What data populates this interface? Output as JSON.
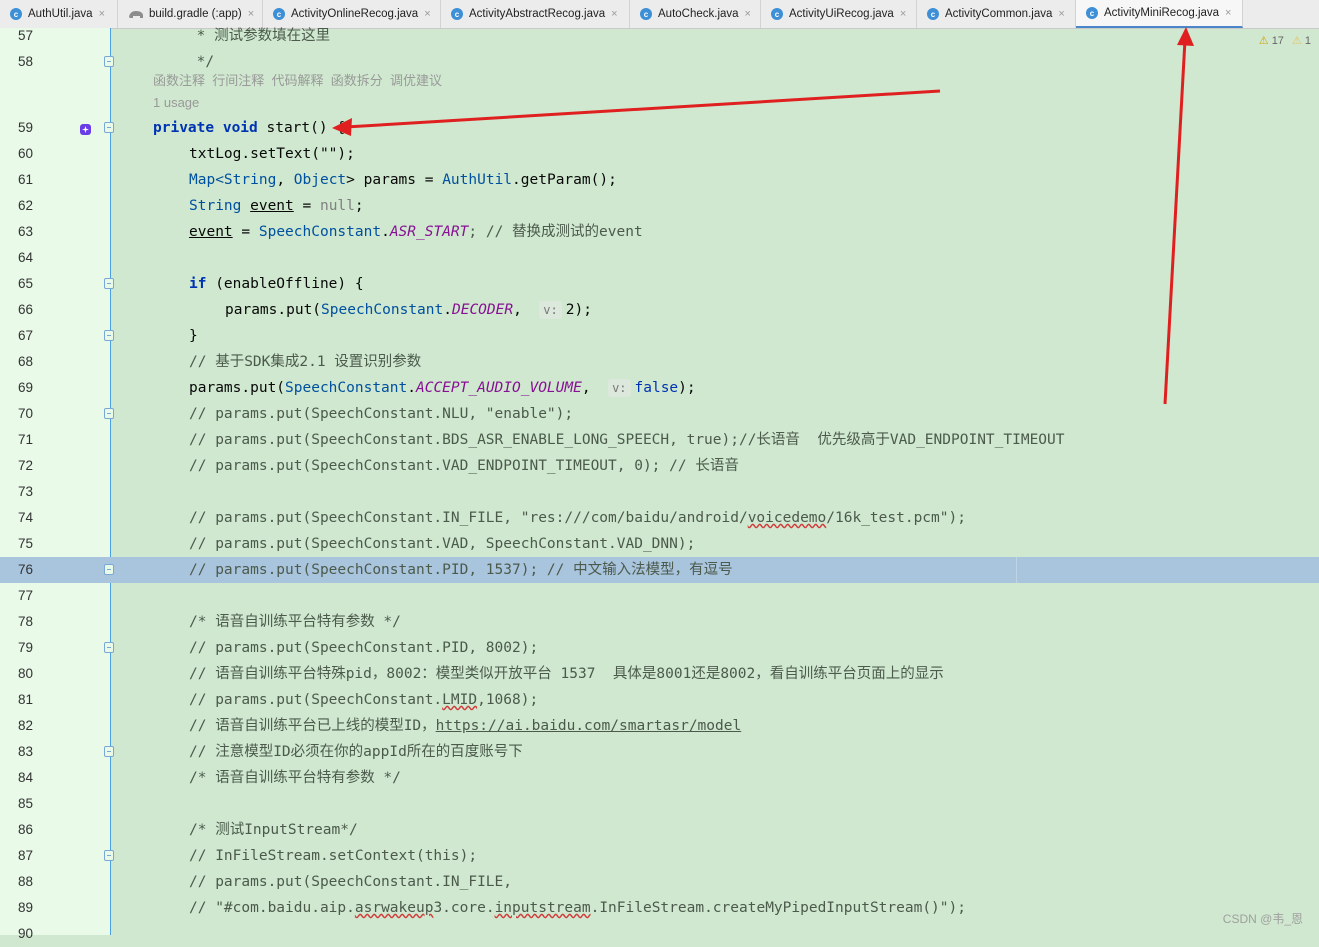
{
  "tabs": [
    {
      "label": "AuthUtil.java",
      "icon": "java-class-icon",
      "active": false
    },
    {
      "label": "build.gradle (:app)",
      "icon": "gradle-elephant-icon",
      "active": false
    },
    {
      "label": "ActivityOnlineRecog.java",
      "icon": "java-class-icon",
      "active": false
    },
    {
      "label": "ActivityAbstractRecog.java",
      "icon": "java-class-icon",
      "active": false
    },
    {
      "label": "AutoCheck.java",
      "icon": "java-class-icon",
      "active": false
    },
    {
      "label": "ActivityUiRecog.java",
      "icon": "java-class-icon",
      "active": false
    },
    {
      "label": "ActivityCommon.java",
      "icon": "java-class-icon",
      "active": false
    },
    {
      "label": "ActivityMiniRecog.java",
      "icon": "java-class-icon",
      "active": true
    }
  ],
  "close_glyph": "×",
  "class_glyph": "c",
  "warnings": {
    "count_a": "17",
    "count_b": "1"
  },
  "ai_actions": [
    "函数注释",
    "行间注释",
    "代码解释",
    "函数拆分",
    "调优建议"
  ],
  "usage_label": "1 usage",
  "line_numbers": [
    "57",
    "58",
    "59",
    "60",
    "61",
    "62",
    "63",
    "64",
    "65",
    "66",
    "67",
    "68",
    "69",
    "70",
    "71",
    "72",
    "73",
    "74",
    "75",
    "76",
    "77",
    "78",
    "79",
    "80",
    "81",
    "82",
    "83",
    "84",
    "85",
    "86",
    "87",
    "88",
    "89",
    "90"
  ],
  "inlay_hint": "v:",
  "code": {
    "l57": "     * 测试参数填在这里",
    "l58": "     */",
    "l59_kw": "private void",
    "l59_rest": " start() {",
    "l60": "txtLog.setText(\"\");",
    "l61_a": "Map<",
    "l61_b": "String",
    "l61_c": ", ",
    "l61_d": "Object",
    "l61_e": "> params = ",
    "l61_f": "AuthUtil",
    "l61_g": ".getParam();",
    "l62_a": "String ",
    "l62_b": "event",
    "l62_c": " = ",
    "l62_d": "null",
    "l62_e": ";",
    "l63_a": "event",
    "l63_b": " = ",
    "l63_c": "SpeechConstant",
    "l63_d": ".",
    "l63_e": "ASR_START",
    "l63_f": "; // 替换成测试的event",
    "l65_a": "if",
    "l65_b": " (enableOffline) {",
    "l66_a": "params.put(",
    "l66_b": "SpeechConstant",
    "l66_c": ".",
    "l66_d": "DECODER",
    "l66_e": ",  ",
    "l66_f": "2);",
    "l67": "}",
    "l68": "// 基于SDK集成2.1 设置识别参数",
    "l69_a": "params.put(",
    "l69_b": "SpeechConstant",
    "l69_c": ".",
    "l69_d": "ACCEPT_AUDIO_VOLUME",
    "l69_e": ",  ",
    "l69_f": "false",
    "l69_g": ");",
    "l70": "// params.put(SpeechConstant.NLU, \"enable\");",
    "l71": "// params.put(SpeechConstant.BDS_ASR_ENABLE_LONG_SPEECH, true);//长语音  优先级高于VAD_ENDPOINT_TIMEOUT",
    "l72": "// params.put(SpeechConstant.VAD_ENDPOINT_TIMEOUT, 0); // 长语音",
    "l74_a": "// params.put(SpeechConstant.IN_FILE, \"res:///com/baidu/android/",
    "l74_b": "voicedemo",
    "l74_c": "/16k_test.pcm\");",
    "l75": "// params.put(SpeechConstant.VAD, SpeechConstant.VAD_DNN);",
    "l76": "// params.put(SpeechConstant.PID, 1537); // 中文输入法模型，有逗号",
    "l78": "/* 语音自训练平台特有参数 */",
    "l79": "// params.put(SpeechConstant.PID, 8002);",
    "l80": "// 语音自训练平台特殊pid，8002：模型类似开放平台 1537  具体是8001还是8002，看自训练平台页面上的显示",
    "l81_a": "// params.put(SpeechConstant.",
    "l81_b": "LMID",
    "l81_c": ",1068);",
    "l82_a": "// 语音自训练平台已上线的模型ID，",
    "l82_b": "https://ai.baidu.com/smartasr/model",
    "l83": "// 注意模型ID必须在你的appId所在的百度账号下",
    "l84": "/* 语音自训练平台特有参数 */",
    "l86": "/* 测试InputStream*/",
    "l87": "// InFileStream.setContext(this);",
    "l88": "// params.put(SpeechConstant.IN_FILE,",
    "l89_a": "// \"#com.baidu.aip.",
    "l89_b": "asrwakeup",
    "l89_c": "3.core.",
    "l89_d": "inputstream",
    "l89_e": ".InFileStream.createMyPipedInputStream()\");"
  },
  "watermark": "CSDN @韦_恩",
  "colors": {
    "editor_bg": "#cfe8cf",
    "gutter_bg": "#e9fae9",
    "highlight": "#a9c4dd",
    "arrow": "#e02020",
    "active_tab": "#4a86c8"
  }
}
